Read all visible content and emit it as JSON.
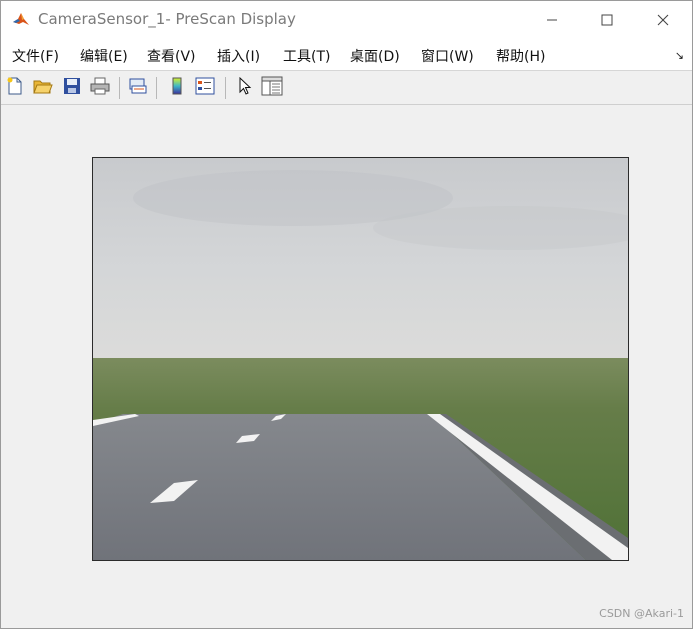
{
  "window": {
    "title": "CameraSensor_1- PreScan Display",
    "app_icon": "matlab-icon",
    "controls": [
      "minimize-icon",
      "maximize-icon",
      "close-icon"
    ]
  },
  "menu": {
    "items": [
      "文件(F)",
      "编辑(E)",
      "查看(V)",
      "插入(I)",
      "工具(T)",
      "桌面(D)",
      "窗口(W)",
      "帮助(H)"
    ],
    "overflow": "↘"
  },
  "toolbar": {
    "buttons": [
      "new-figure-icon",
      "open-file-icon",
      "save-icon",
      "print-icon",
      "link-plot-icon",
      "colorbar-icon",
      "legend-icon",
      "pointer-icon",
      "property-editor-icon"
    ]
  },
  "display": {
    "scene": "camera-view-road-with-lane-markings",
    "colors": {
      "sky": "#d6d8da",
      "grass": "#5f7a45",
      "road": "#7b7e84",
      "marking": "#ffffff"
    }
  },
  "watermark": "CSDN @Akari-1"
}
